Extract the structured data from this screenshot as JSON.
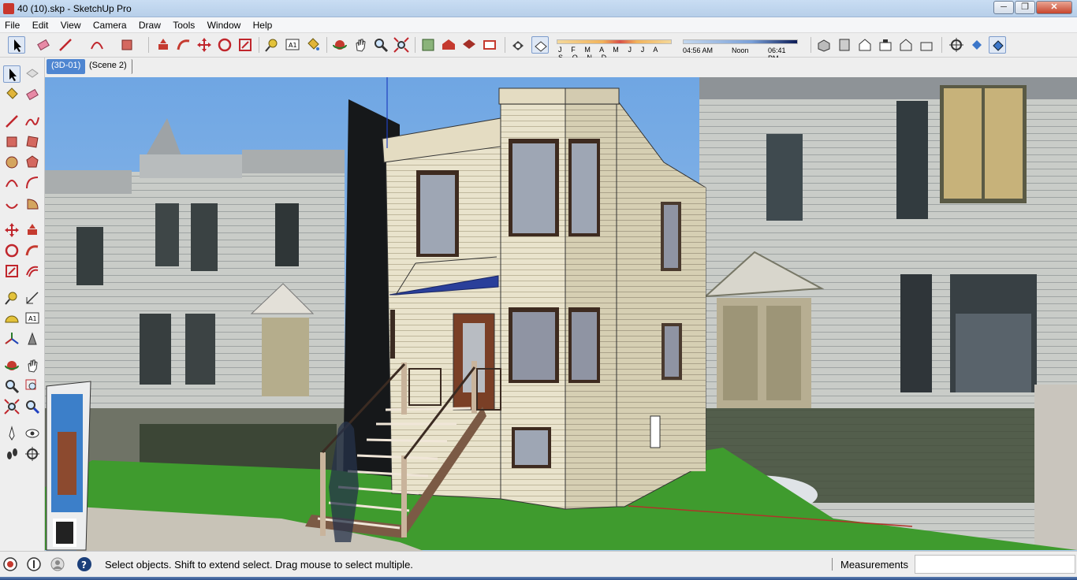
{
  "window": {
    "title": "40 (10).skp - SketchUp Pro",
    "min_label": "─",
    "max_label": "❐",
    "close_label": "✕"
  },
  "menu": [
    "File",
    "Edit",
    "View",
    "Camera",
    "Draw",
    "Tools",
    "Window",
    "Help"
  ],
  "shadows": {
    "months_label": "J F M A M J J A S O N D",
    "time_start": "04:56 AM",
    "time_mid": "Noon",
    "time_end": "06:41 PM"
  },
  "scenes": [
    {
      "label": "(3D-01)",
      "active": true
    },
    {
      "label": "(Scene 2)",
      "active": false
    }
  ],
  "status": {
    "message": "Select objects. Shift to extend select. Drag mouse to select multiple.",
    "measurements_label": "Measurements",
    "measurements_value": ""
  },
  "colors": {
    "accent": "#4f86d1",
    "sky": "#7fb0e6",
    "grass": "#3f9b2e",
    "siding": "#e9e3cc",
    "awning": "#2a3f9a"
  }
}
